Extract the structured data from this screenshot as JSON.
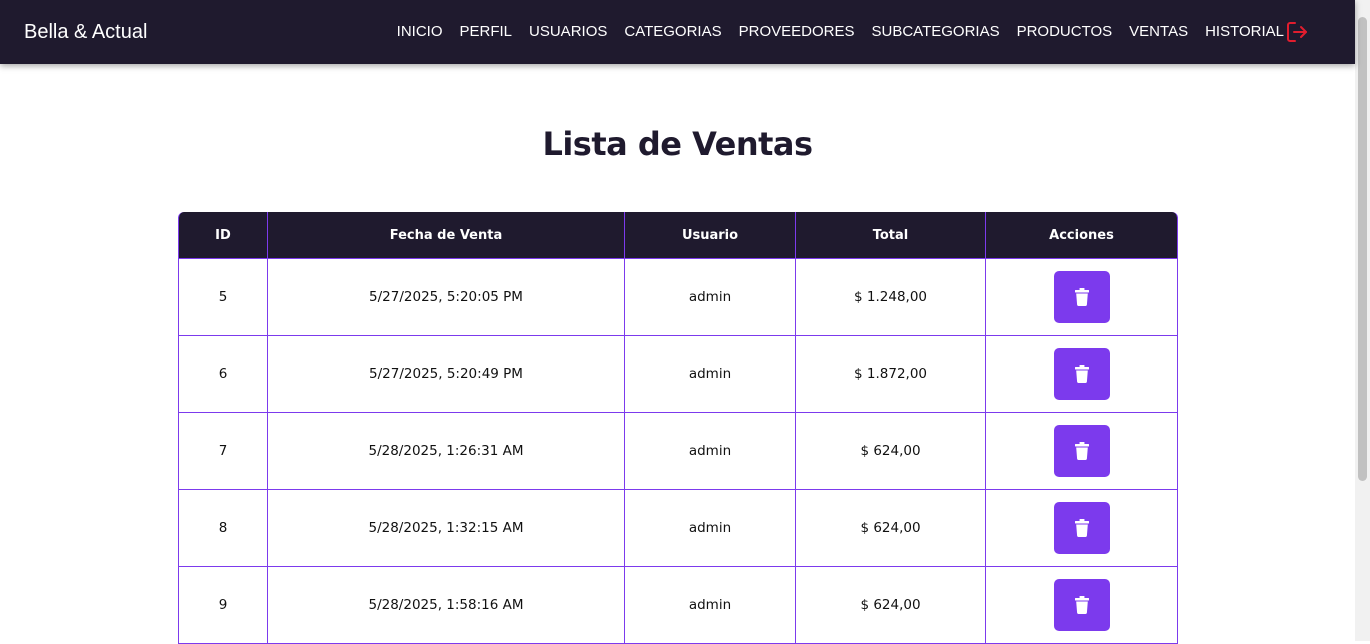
{
  "header": {
    "brand": "Bella & Actual",
    "nav": [
      {
        "label": "INICIO"
      },
      {
        "label": "PERFIL"
      },
      {
        "label": "USUARIOS"
      },
      {
        "label": "CATEGORIAS"
      },
      {
        "label": "PROVEEDORES"
      },
      {
        "label": "SUBCATEGORIAS"
      },
      {
        "label": "PRODUCTOS"
      },
      {
        "label": "VENTAS"
      },
      {
        "label": "HISTORIAL"
      }
    ],
    "logout_icon": "logout-icon"
  },
  "main": {
    "title": "Lista de Ventas",
    "table": {
      "columns": [
        "ID",
        "Fecha de Venta",
        "Usuario",
        "Total",
        "Acciones"
      ],
      "rows": [
        {
          "id": "5",
          "fecha": "5/27/2025, 5:20:05 PM",
          "usuario": "admin",
          "total": "$ 1.248,00",
          "action_icon": "trash-icon"
        },
        {
          "id": "6",
          "fecha": "5/27/2025, 5:20:49 PM",
          "usuario": "admin",
          "total": "$ 1.872,00",
          "action_icon": "trash-icon"
        },
        {
          "id": "7",
          "fecha": "5/28/2025, 1:26:31 AM",
          "usuario": "admin",
          "total": "$ 624,00",
          "action_icon": "trash-icon"
        },
        {
          "id": "8",
          "fecha": "5/28/2025, 1:32:15 AM",
          "usuario": "admin",
          "total": "$ 624,00",
          "action_icon": "trash-icon"
        },
        {
          "id": "9",
          "fecha": "5/28/2025, 1:58:16 AM",
          "usuario": "admin",
          "total": "$ 624,00",
          "action_icon": "trash-icon"
        }
      ]
    }
  },
  "colors": {
    "navbar_bg": "#1f1a2e",
    "accent": "#7c3aed",
    "logout": "#e11d2e"
  }
}
